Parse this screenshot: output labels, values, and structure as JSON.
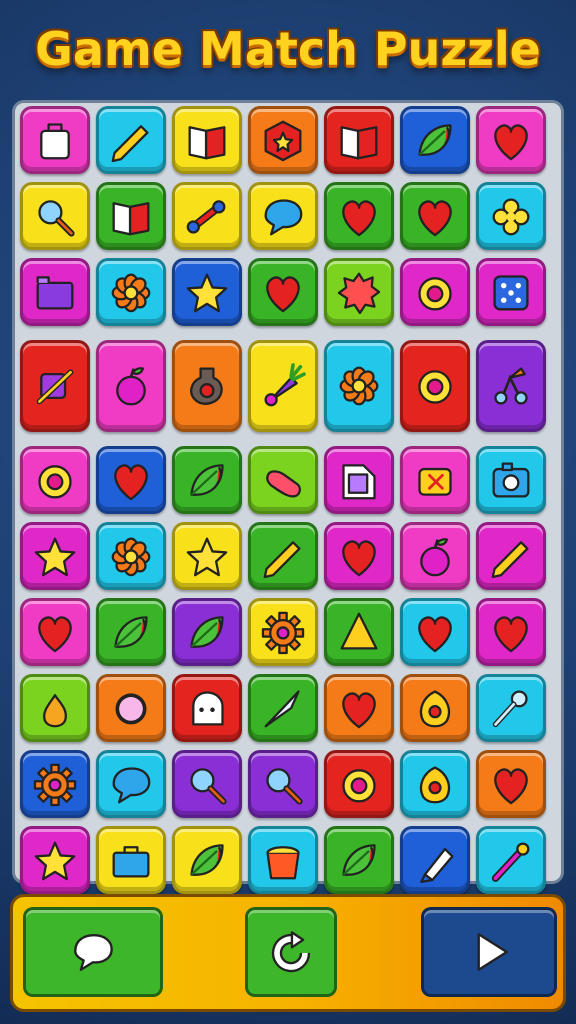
{
  "title": "Game Match Puzzle",
  "colors": {
    "pink": "#f03cc4",
    "cyan": "#22c8ea",
    "yellow": "#f8e11a",
    "orange": "#f57b18",
    "red": "#e3241f",
    "blue": "#1f5fd8",
    "green": "#39b426",
    "lime": "#7bd320",
    "purple": "#8a2fd6",
    "magenta": "#e028c8"
  },
  "grid": {
    "rows": [
      [
        {
          "bg": "pink",
          "icon": "bag-icon"
        },
        {
          "bg": "cyan",
          "icon": "pencil-icon"
        },
        {
          "bg": "yellow",
          "icon": "book-icon"
        },
        {
          "bg": "orange",
          "icon": "badge-icon"
        },
        {
          "bg": "red",
          "icon": "book-icon"
        },
        {
          "bg": "blue",
          "icon": "leaf-icon"
        },
        {
          "bg": "pink",
          "icon": "heart-icon"
        }
      ],
      [
        {
          "bg": "yellow",
          "icon": "magnifier-icon"
        },
        {
          "bg": "green",
          "icon": "book-icon"
        },
        {
          "bg": "yellow",
          "icon": "candy-icon"
        },
        {
          "bg": "yellow",
          "icon": "speech-bubble-icon"
        },
        {
          "bg": "green",
          "icon": "heart-icon"
        },
        {
          "bg": "green",
          "icon": "heart-icon"
        },
        {
          "bg": "cyan",
          "icon": "clover-icon"
        }
      ],
      [
        {
          "bg": "magenta",
          "icon": "box-icon"
        },
        {
          "bg": "cyan",
          "icon": "flower-icon"
        },
        {
          "bg": "blue",
          "icon": "star-icon"
        },
        {
          "bg": "green",
          "icon": "heart-icon"
        },
        {
          "bg": "lime",
          "icon": "splat-icon"
        },
        {
          "bg": "magenta",
          "icon": "ring-icon"
        },
        {
          "bg": "magenta",
          "icon": "dice-icon"
        }
      ],
      [
        {
          "bg": "red",
          "icon": "wand-icon"
        },
        {
          "bg": "pink",
          "icon": "fruit-icon"
        },
        {
          "bg": "orange",
          "icon": "potion-icon"
        },
        {
          "bg": "yellow",
          "icon": "carrot-icon"
        },
        {
          "bg": "cyan",
          "icon": "flower-icon"
        },
        {
          "bg": "red",
          "icon": "ring-icon"
        },
        {
          "bg": "purple",
          "icon": "cherry-icon"
        }
      ],
      [
        {
          "bg": "pink",
          "icon": "ring-icon"
        },
        {
          "bg": "blue",
          "icon": "heart-icon"
        },
        {
          "bg": "green",
          "icon": "leaf-icon"
        },
        {
          "bg": "lime",
          "icon": "pill-icon"
        },
        {
          "bg": "magenta",
          "icon": "folder-icon"
        },
        {
          "bg": "pink",
          "icon": "gem-icon"
        },
        {
          "bg": "cyan",
          "icon": "camera-icon"
        }
      ],
      [
        {
          "bg": "magenta",
          "icon": "star-icon"
        },
        {
          "bg": "cyan",
          "icon": "flower-icon"
        },
        {
          "bg": "yellow",
          "icon": "star-icon"
        },
        {
          "bg": "green",
          "icon": "pencil-icon"
        },
        {
          "bg": "magenta",
          "icon": "heart-icon"
        },
        {
          "bg": "pink",
          "icon": "fruit-icon"
        },
        {
          "bg": "magenta",
          "icon": "pencil-icon"
        }
      ],
      [
        {
          "bg": "pink",
          "icon": "heart-icon"
        },
        {
          "bg": "green",
          "icon": "leaf-icon"
        },
        {
          "bg": "purple",
          "icon": "leaf-icon"
        },
        {
          "bg": "yellow",
          "icon": "gear-icon"
        },
        {
          "bg": "green",
          "icon": "cone-icon"
        },
        {
          "bg": "cyan",
          "icon": "heart-icon"
        },
        {
          "bg": "magenta",
          "icon": "heart-icon"
        }
      ],
      [
        {
          "bg": "lime",
          "icon": "pear-icon"
        },
        {
          "bg": "orange",
          "icon": "mirror-icon"
        },
        {
          "bg": "red",
          "icon": "ghost-icon"
        },
        {
          "bg": "green",
          "icon": "blade-icon"
        },
        {
          "bg": "orange",
          "icon": "heart-icon"
        },
        {
          "bg": "orange",
          "icon": "lemon-icon"
        },
        {
          "bg": "cyan",
          "icon": "key-icon"
        }
      ],
      [
        {
          "bg": "blue",
          "icon": "gear-icon"
        },
        {
          "bg": "cyan",
          "icon": "speech-bubble-icon"
        },
        {
          "bg": "purple",
          "icon": "magnifier-icon"
        },
        {
          "bg": "purple",
          "icon": "magnifier-icon"
        },
        {
          "bg": "red",
          "icon": "ring-icon"
        },
        {
          "bg": "cyan",
          "icon": "lemon-icon"
        },
        {
          "bg": "orange",
          "icon": "heart-icon"
        }
      ],
      [
        {
          "bg": "magenta",
          "icon": "star-icon"
        },
        {
          "bg": "yellow",
          "icon": "briefcase-icon"
        },
        {
          "bg": "yellow",
          "icon": "leaf-icon"
        },
        {
          "bg": "cyan",
          "icon": "cup-icon"
        },
        {
          "bg": "green",
          "icon": "leaf-icon"
        },
        {
          "bg": "blue",
          "icon": "marker-icon"
        },
        {
          "bg": "cyan",
          "icon": "brush-icon"
        }
      ]
    ]
  },
  "toolbar": {
    "buttons": [
      {
        "name": "hint-button",
        "icon": "speech-bubble-icon",
        "bg": "#3db62a"
      },
      {
        "name": "restart-button",
        "icon": "refresh-icon",
        "bg": "#3db62a"
      },
      {
        "name": "play-button",
        "icon": "play-icon",
        "bg": "#1d4a8f"
      }
    ]
  }
}
